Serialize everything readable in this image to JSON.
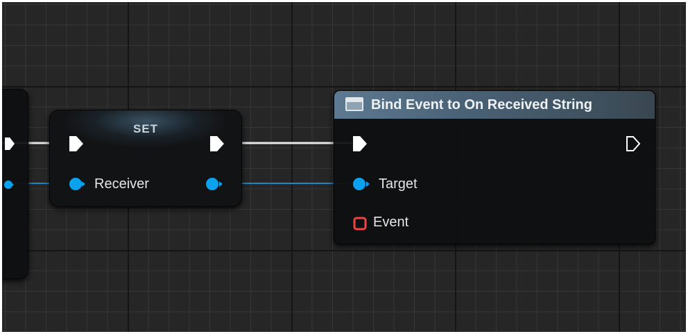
{
  "set_node": {
    "title": "SET",
    "receiver_label": "Receiver"
  },
  "bind_node": {
    "title": "Bind Event to On Received String",
    "target_label": "Target",
    "event_label": "Event"
  },
  "colors": {
    "exec_wire": "#ffffff",
    "object_pin": "#0aa1ee",
    "delegate_pin": "#f04444",
    "node_header": "#5d7a92"
  },
  "icons": {
    "exec_pin": "pentagon-arrow",
    "object_pin": "circle-with-arrow",
    "delegate_pin": "rounded-square",
    "header_icon": "window-icon"
  }
}
